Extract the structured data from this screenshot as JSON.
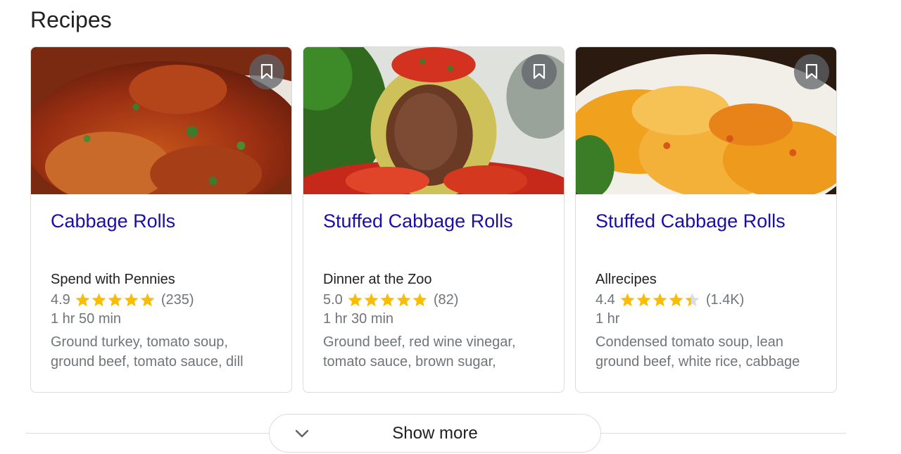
{
  "section": {
    "title": "Recipes"
  },
  "cards": [
    {
      "title": "Cabbage Rolls",
      "source": "Spend with Pennies",
      "rating": "4.9",
      "stars": 4.9,
      "review_count": "(235)",
      "time": "1 hr 50 min",
      "ingredients": "Ground turkey, tomato soup, ground beef, tomato sauce, dill"
    },
    {
      "title": "Stuffed Cabbage Rolls",
      "source": "Dinner at the Zoo",
      "rating": "5.0",
      "stars": 5.0,
      "review_count": "(82)",
      "time": "1 hr 30 min",
      "ingredients": "Ground beef, red wine vinegar, tomato sauce, brown sugar,"
    },
    {
      "title": "Stuffed Cabbage Rolls",
      "source": "Allrecipes",
      "rating": "4.4",
      "stars": 4.4,
      "review_count": "(1.4K)",
      "time": "1 hr",
      "ingredients": "Condensed tomato soup, lean ground beef, white rice, cabbage"
    }
  ],
  "show_more": {
    "label": "Show more",
    "icon": "chevron-down-icon"
  },
  "colors": {
    "title_link": "#1a0dab",
    "star": "#fbbc04",
    "star_empty": "#dadce0",
    "meta_text": "#70757a"
  }
}
